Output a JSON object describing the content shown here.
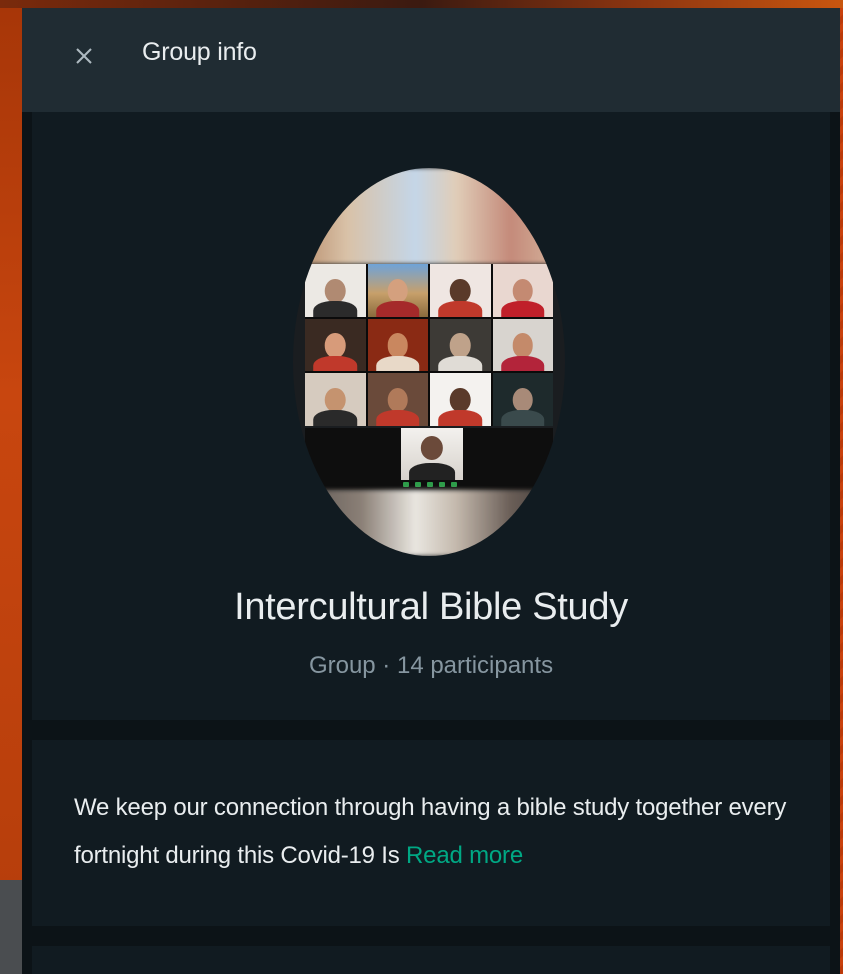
{
  "header": {
    "close_icon": "close-icon",
    "title": "Group info"
  },
  "profile": {
    "avatar_description": "group-photo-video-call",
    "name": "Intercultural Bible Study",
    "meta": "Group · 14 participants"
  },
  "description": {
    "text": "We keep our connection through having a bible study together every fortnight during this Covid-19 Is",
    "read_more": "Read more"
  },
  "colors": {
    "accent": "#00a884",
    "header_bg": "#202c33",
    "panel_bg": "#111b21",
    "text_primary": "#e9edef",
    "text_secondary": "#8696a0"
  }
}
